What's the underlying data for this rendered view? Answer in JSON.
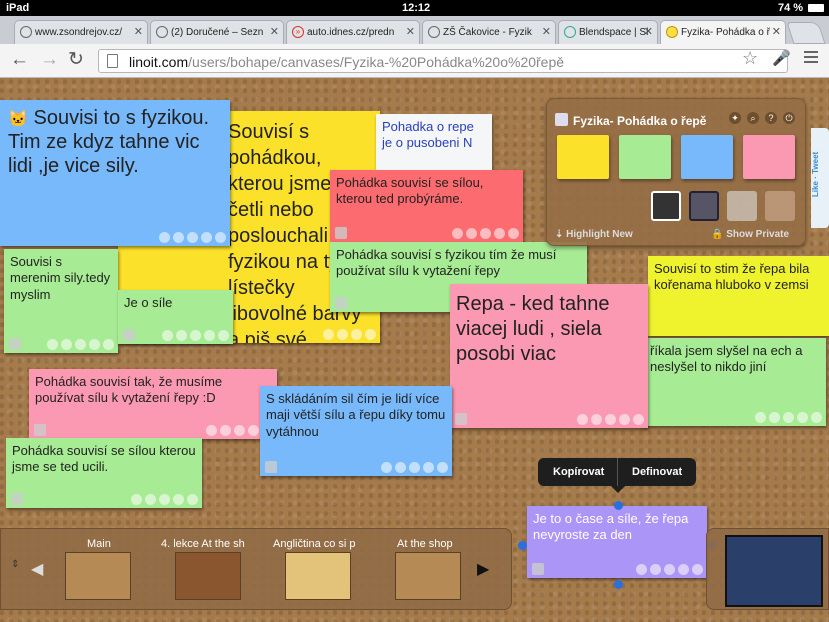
{
  "status": {
    "device": "iPad",
    "time": "12:12",
    "battery": "74 %"
  },
  "tabs": [
    {
      "label": "www.zsondrejov.cz/",
      "active": false
    },
    {
      "label": "(2) Doručené – Sezn",
      "active": false
    },
    {
      "label": "auto.idnes.cz/predn",
      "active": false
    },
    {
      "label": "ZŠ Čakovice - Fyzik",
      "active": false
    },
    {
      "label": "Blendspace | Sl",
      "active": false
    },
    {
      "label": "Fyzika- Pohádka o ř",
      "active": true
    }
  ],
  "address": {
    "host": "linoit.com",
    "path": "/users/bohape/canvases/Fyzika-%20Pohádka%20o%20řepě"
  },
  "panel": {
    "title": "Fyzika- Pohádka o řepě",
    "highlight": "Highlight New",
    "show_private": "Show Private"
  },
  "social": {
    "tweet": "Tweet",
    "like": "Like"
  },
  "notes": [
    {
      "id": "n1",
      "text": "Souvisi to s fyzikou. Tim ze kdyz tahne vic lidi ,je vice sily."
    },
    {
      "id": "n2",
      "text": "Souvisí s pohádkou, kterou jsme četli nebo poslouchali, s fyzikou na tyto lístečky libovolné barvy a piš své nápady."
    },
    {
      "id": "n3",
      "text": "Pohadka o repe je o pusobeni N"
    },
    {
      "id": "n4",
      "text": "Pohádka souvisí se sílou, kterou ted probýráme."
    },
    {
      "id": "n5",
      "text": "Pohádka souvisí s fyzikou tím že musí používat sílu k vytažení řepy"
    },
    {
      "id": "n6",
      "text": "Souvisi s merenim sily.tedy myslim"
    },
    {
      "id": "n7",
      "text": "Je o síle"
    },
    {
      "id": "n8",
      "text": "Repa - ked tahne viacej ludi , siela posobi viac"
    },
    {
      "id": "n9",
      "text": "Souvisí to stim že řepa bila kořenama hluboko v zemsi"
    },
    {
      "id": "n10",
      "text": "říkala jsem slyšel na ech a neslyšel to nikdo jiní"
    },
    {
      "id": "n11",
      "text": "Pohádka souvisí tak, že musíme používat sílu k vytažení řepy :D"
    },
    {
      "id": "n12",
      "text": "S skládáním sil čím je lidí více maji větší sílu a řepu díky tomu vytáhnou"
    },
    {
      "id": "n13",
      "text": "Pohádka souvisí se sílou kterou jsme se ted ucili."
    },
    {
      "id": "n14",
      "text": "Je to o čase a síle, že řepa nevyroste za den"
    }
  ],
  "popup": {
    "copy": "Kopírovat",
    "define": "Definovat"
  },
  "boards": [
    {
      "label": "Main"
    },
    {
      "label": "4. lekce At the sh"
    },
    {
      "label": "Angličtina co si p"
    },
    {
      "label": "At the shop"
    }
  ]
}
